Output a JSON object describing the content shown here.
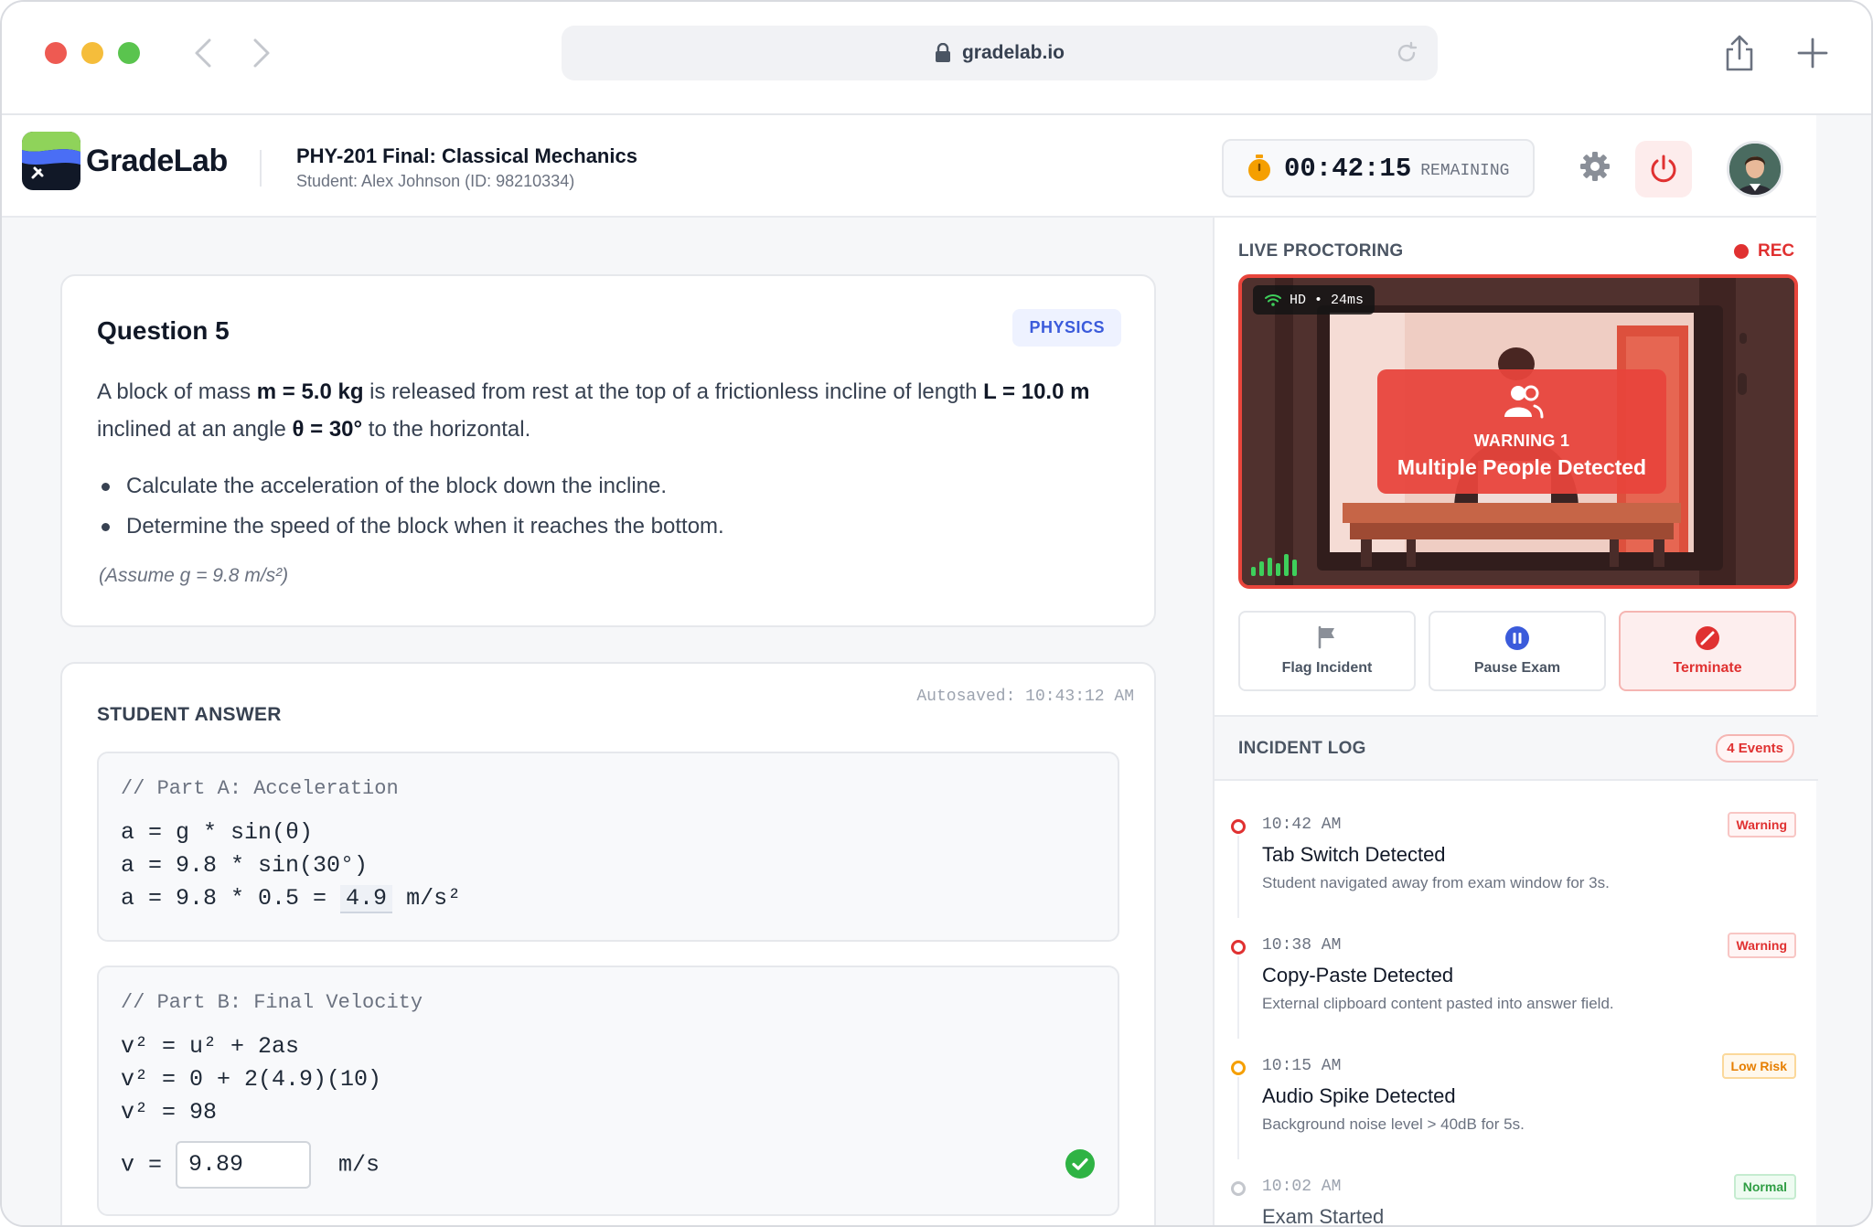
{
  "browser": {
    "url": "gradelab.io"
  },
  "brand": {
    "name": "GradeLab"
  },
  "exam": {
    "title": "PHY-201 Final: Classical Mechanics",
    "student": "Student: Alex Johnson (ID: 98210334)"
  },
  "timer": {
    "value": "00:42:15",
    "label": "REMAINING"
  },
  "question": {
    "title": "Question 5",
    "tag": "PHYSICS",
    "text_parts": {
      "p1": "A block of mass ",
      "b1": "m = 5.0 kg",
      "p2": " is released from rest at the top of a frictionless incline of length ",
      "b2": "L = 10.0 m",
      "p3": " inclined at an angle ",
      "b3": "θ = 30°",
      "p4": " to the horizontal."
    },
    "bullets": [
      "Calculate the acceleration of the block down the incline.",
      "Determine the speed of the block when it reaches the bottom."
    ],
    "note": "(Assume g = 9.8 m/s²)"
  },
  "answer": {
    "heading": "STUDENT ANSWER",
    "autosaved": "Autosaved: 10:43:12 AM",
    "part_a": {
      "comment": "// Part A: Acceleration",
      "lines": [
        "a = g * sin(θ)",
        "a = 9.8 * sin(30°)"
      ],
      "line3_prefix": "a = 9.8 * 0.5 = ",
      "line3_value": "4.9",
      "line3_unit": " m/s²"
    },
    "part_b": {
      "comment": "// Part B: Final Velocity",
      "lines": [
        "v² = u² + 2as",
        "v² = 0 + 2(4.9)(10)",
        "v² = 98"
      ],
      "final_prefix": "v = ",
      "final_value": "9.89",
      "final_unit": "m/s"
    }
  },
  "proctoring": {
    "label": "LIVE PROCTORING",
    "rec": "REC",
    "video_badge": "HD • 24ms",
    "warning_small": "WARNING 1",
    "warning_big": "Multiple People Detected",
    "actions": [
      "Flag Incident",
      "Pause Exam",
      "Terminate"
    ]
  },
  "incident_log": {
    "label": "INCIDENT LOG",
    "count": "4 Events",
    "items": [
      {
        "time": "10:42 AM",
        "title": "Tab Switch Detected",
        "desc": "Student navigated away from exam window for 3s.",
        "badge": "Warning"
      },
      {
        "time": "10:38 AM",
        "title": "Copy-Paste Detected",
        "desc": "External clipboard content pasted into answer field.",
        "badge": "Warning"
      },
      {
        "time": "10:15 AM",
        "title": "Audio Spike Detected",
        "desc": "Background noise level > 40dB for 5s.",
        "badge": "Low Risk"
      },
      {
        "time": "10:02 AM",
        "title": "Exam Started",
        "desc": "",
        "badge": "Normal"
      }
    ]
  },
  "colors": {
    "accent": "#3b5bdb",
    "danger": "#e03131",
    "warning": "#e67e00",
    "success": "#2f9e44"
  }
}
